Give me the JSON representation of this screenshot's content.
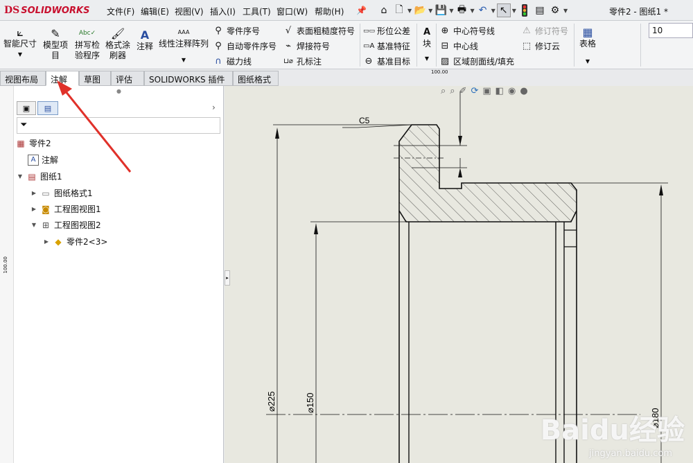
{
  "app": {
    "logo_ds": "DS",
    "logo_text": "SOLIDWORKS",
    "window_title": "零件2 - 图纸1 *"
  },
  "menu": [
    "文件(F)",
    "编辑(E)",
    "视图(V)",
    "插入(I)",
    "工具(T)",
    "窗口(W)",
    "帮助(H)"
  ],
  "ribbon": {
    "smart_dimension": "智能尺寸",
    "model_items_1": "模型项",
    "model_items_2": "目",
    "spell_checker_1": "拼写检",
    "spell_checker_2": "验程序",
    "format_painter_1": "格式涂",
    "format_painter_2": "刷器",
    "note": "注释",
    "linear_note_pattern": "线性注释阵列",
    "balloon": "零件序号",
    "auto_balloon": "自动零件序号",
    "magnetic_line": "磁力线",
    "surface_finish": "表面粗糙度符号",
    "weld_symbol": "焊接符号",
    "hole_callout": "孔标注",
    "geometric_tolerance": "形位公差",
    "datum_feature": "基准特征",
    "datum_target": "基准目标",
    "block": "块",
    "center_mark": "中心符号线",
    "centerline": "中心线",
    "area_hatch": "区域剖面线/填充",
    "revision_symbol": "修订符号",
    "revision_cloud": "修订云",
    "table": "表格",
    "font_size_value": "10"
  },
  "tabs": [
    {
      "label": "视图布局",
      "active": false
    },
    {
      "label": "注解",
      "active": true
    },
    {
      "label": "草图",
      "active": false
    },
    {
      "label": "评估",
      "active": false
    },
    {
      "label": "SOLIDWORKS 插件",
      "active": false
    },
    {
      "label": "图纸格式",
      "active": false
    }
  ],
  "tree": {
    "root": "零件2",
    "annotations": "注解",
    "sheet": "图纸1",
    "sheet_format": "图纸格式1",
    "drawing_view1": "工程图视图1",
    "drawing_view2": "工程图视图2",
    "part_ref": "零件2<3>"
  },
  "drawing": {
    "chamfer_label": "C5",
    "dim_225": "⌀225",
    "dim_150": "⌀150",
    "dim_180": "⌀180",
    "ruler_top": "100.00",
    "ruler_left": "100.00"
  },
  "watermark": {
    "main": "Baidu经验",
    "sub": "jingyan.baidu.com"
  },
  "colors": {
    "accent_red": "#e0312a",
    "logo_red": "#c8102e"
  }
}
